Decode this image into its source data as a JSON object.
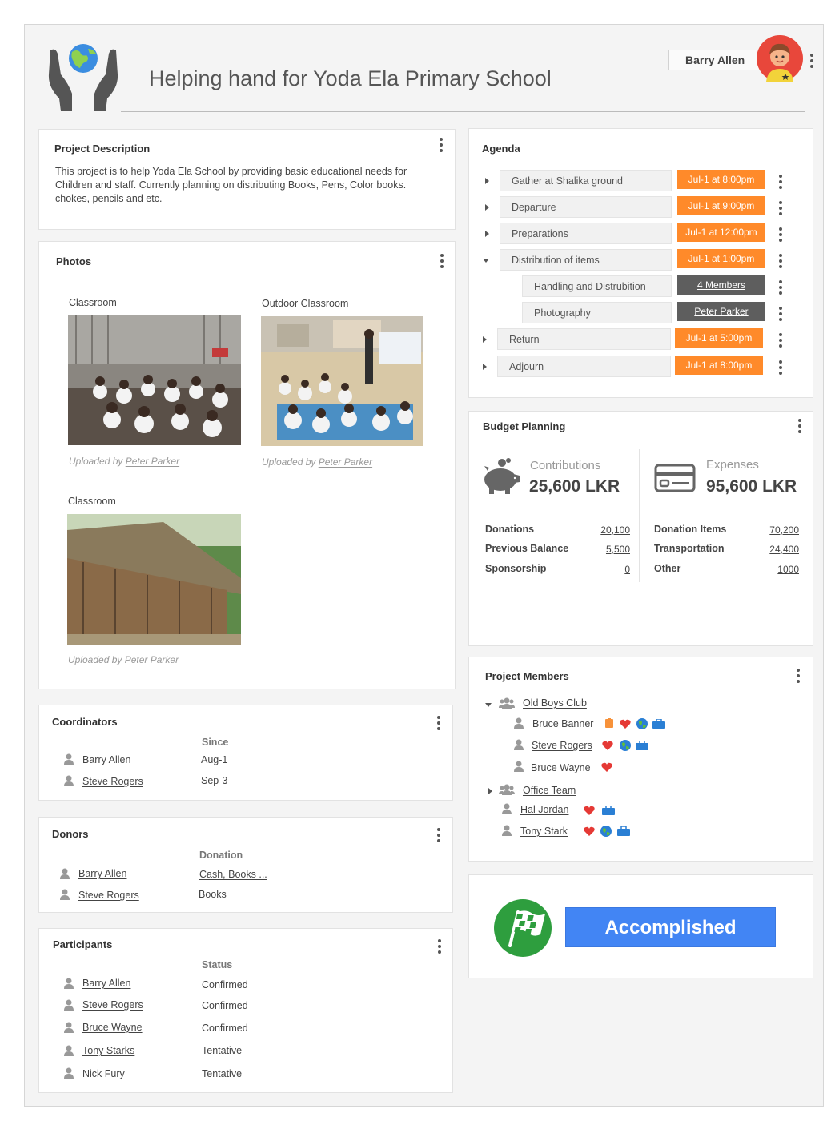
{
  "header": {
    "title": "Helping hand for Yoda Ela Primary School",
    "user_name": "Barry Allen"
  },
  "description": {
    "title": "Project Description",
    "line1": "This project is to help Yoda Ela School by providing basic educational needs for",
    "line2": "Children and staff. Currently planning on distributing Books, Pens, Color books.",
    "line3": "chokes, pencils and etc."
  },
  "photos": {
    "title": "Photos",
    "items": [
      {
        "caption": "Classroom",
        "uploaded_prefix": "Uploaded by",
        "uploader": "Peter Parker"
      },
      {
        "caption": "Outdoor Classroom",
        "uploaded_prefix": "Uploaded by",
        "uploader": "Peter Parker"
      },
      {
        "caption": "Classroom",
        "uploaded_prefix": "Uploaded by",
        "uploader": "Peter Parker"
      }
    ]
  },
  "coordinators": {
    "title": "Coordinators",
    "col": "Since",
    "rows": [
      {
        "name": "Barry Allen",
        "value": "Aug-1"
      },
      {
        "name": "Steve Rogers",
        "value": "Sep-3"
      }
    ]
  },
  "donors": {
    "title": "Donors",
    "col": "Donation",
    "rows": [
      {
        "name": "Barry Allen",
        "value": "Cash, Books ..."
      },
      {
        "name": "Steve Rogers",
        "value": "Books"
      }
    ]
  },
  "participants": {
    "title": "Participants",
    "col": "Status",
    "rows": [
      {
        "name": "Barry Allen",
        "value": "Confirmed"
      },
      {
        "name": "Steve Rogers",
        "value": "Confirmed"
      },
      {
        "name": "Bruce Wayne",
        "value": "Confirmed"
      },
      {
        "name": "Tony Starks",
        "value": "Tentative"
      },
      {
        "name": "Nick Fury",
        "value": "Tentative"
      }
    ]
  },
  "agenda": {
    "title": "Agenda",
    "items": [
      {
        "label": "Gather at Shalika ground",
        "time": "Jul-1 at 8:00pm"
      },
      {
        "label": "Departure",
        "time": "Jul-1 at 9:00pm"
      },
      {
        "label": "Preparations",
        "time": "Jul-1 at 12:00pm"
      },
      {
        "label": "Distribution of items",
        "time": "Jul-1 at 1:00pm"
      },
      {
        "label": "Handling and Distrubition",
        "time": "4 Members"
      },
      {
        "label": "Photography",
        "time": "Peter Parker"
      },
      {
        "label": "Return",
        "time": "Jul-1 at 5:00pm"
      },
      {
        "label": "Adjourn",
        "time": "Jul-1 at 8:00pm"
      }
    ]
  },
  "budget": {
    "title": "Budget Planning",
    "contrib_label": "Contributions",
    "contrib_amount": "25,600 LKR",
    "expense_label": "Expenses",
    "expense_amount": "95,600 LKR",
    "contrib_rows": [
      {
        "label": "Donations",
        "value": "20,100"
      },
      {
        "label": "Previous Balance",
        "value": "5,500"
      },
      {
        "label": "Sponsorship",
        "value": "0"
      }
    ],
    "expense_rows": [
      {
        "label": "Donation Items",
        "value": "70,200"
      },
      {
        "label": "Transportation",
        "value": "24,400"
      },
      {
        "label": "Other",
        "value": "1000"
      }
    ]
  },
  "members": {
    "title": "Project Members",
    "group1": "Old Boys Club",
    "g1": [
      "Bruce Banner",
      "Steve Rogers",
      "Bruce Wayne"
    ],
    "group2": "Office Team",
    "others": [
      "Hal Jordan",
      "Tony Stark"
    ]
  },
  "status": {
    "label": "Accomplished"
  },
  "colors": {
    "accent_orange": "#ff8a2a",
    "accent_blue": "#4285f4",
    "flag_green": "#2e9e3e"
  }
}
